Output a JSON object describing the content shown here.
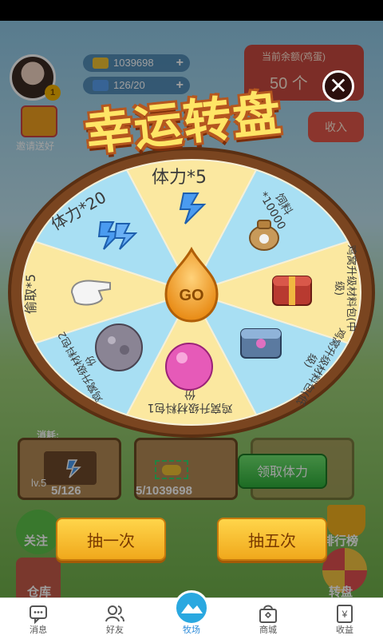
{
  "background": {
    "resources": {
      "gold": "1039698",
      "stamina": "126/20"
    },
    "balance": {
      "label": "当前余额(鸡蛋)",
      "value": "50 个"
    },
    "withdraw_label": "收入",
    "invite_label": "邀请送好",
    "consume_label": "消耗:",
    "barn_left": {
      "level": "lv.5"
    },
    "stamina_count": "5/126",
    "gold_count": "5/1039698",
    "claim_button": "领取体力",
    "side_left_labels": [
      "关注",
      "仓库"
    ],
    "side_right_labels": [
      "排行榜",
      "转盘"
    ],
    "level_badge": "1"
  },
  "dialog": {
    "title": "幸运转盘",
    "go_label": "GO",
    "segments": [
      {
        "label": "体力*5",
        "icon": "stamina-icon"
      },
      {
        "label": "饲料*10000",
        "icon": "feed-bag-icon"
      },
      {
        "label": "鸡窝升级材料包(中级)",
        "icon": "chest-icon"
      },
      {
        "label": "鸡窝升级材料包(低级)",
        "icon": "iron-chest-icon"
      },
      {
        "label": "鸡窝升级材料包1份",
        "icon": "pink-egg-icon"
      },
      {
        "label": "鸡窝升级材料包2份",
        "icon": "stone-egg-icon"
      },
      {
        "label": "偷取*5",
        "icon": "glove-icon"
      },
      {
        "label": "体力*20",
        "icon": "stamina-icon"
      }
    ],
    "draw_once": "抽一次",
    "draw_five": "抽五次",
    "colors": {
      "segment_a": "#fbe8a0",
      "segment_b": "#a8dff3",
      "rim": "#7a4520",
      "go": "#f5a52a"
    }
  },
  "bottom_nav": [
    {
      "label": "消息",
      "icon": "message-icon"
    },
    {
      "label": "好友",
      "icon": "friends-icon"
    },
    {
      "label": "牧场",
      "icon": "ranch-icon",
      "active": true
    },
    {
      "label": "商城",
      "icon": "shop-icon"
    },
    {
      "label": "收益",
      "icon": "income-icon"
    }
  ]
}
